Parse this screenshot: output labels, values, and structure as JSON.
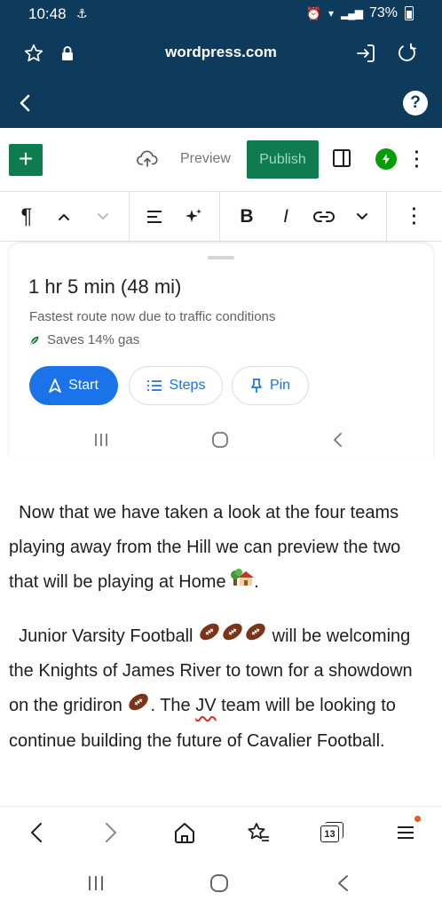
{
  "status_bar": {
    "time": "10:48",
    "battery": "73%"
  },
  "browser": {
    "url": "wordpress.com",
    "tabs_count": "13"
  },
  "editor_toolbar": {
    "preview_label": "Preview",
    "publish_label": "Publish"
  },
  "format_toolbar": {
    "bold_label": "B",
    "italic_label": "I"
  },
  "map_card": {
    "route_time": "1 hr 5 min (48 mi)",
    "route_note": "Fastest route now due to traffic conditions",
    "gas_savings": "Saves 14% gas",
    "start_label": "Start",
    "steps_label": "Steps",
    "pin_label": "Pin"
  },
  "post": {
    "paragraph_1": "Now that we have taken a look at the four teams playing away from the Hill we can preview the two that will be playing at Home",
    "paragraph_2_a": "Junior Varsity Football",
    "paragraph_2_b": "will be welcoming the Knights of James River to town for a showdown on the gridiron",
    "paragraph_2_c": ". The",
    "paragraph_2_jv": "JV",
    "paragraph_2_d": "team will be looking to continue building the future of Cavalier Football."
  },
  "colors": {
    "header_bg": "#0e3a5c",
    "accent_green": "#0e7c4f",
    "maps_blue": "#1a73e8",
    "jetpack_green": "#069e08"
  }
}
